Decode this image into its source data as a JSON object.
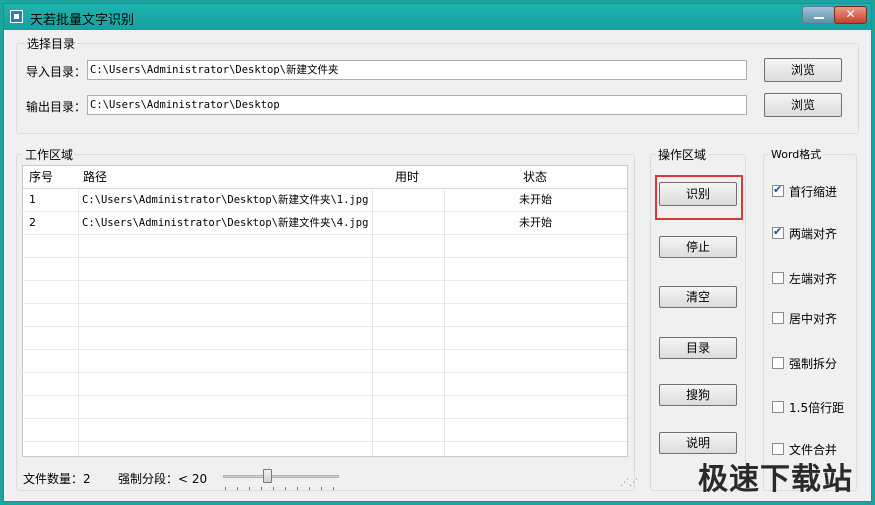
{
  "window": {
    "title": "天若批量文字识别",
    "minimize": "—",
    "close": "✕"
  },
  "directory_group": {
    "title": "选择目录",
    "import_label": "导入目录：",
    "import_value": "C:\\Users\\Administrator\\Desktop\\新建文件夹",
    "export_label": "输出目录：",
    "export_value": "C:\\Users\\Administrator\\Desktop",
    "browse_label": "浏览"
  },
  "work_area": {
    "title": "工作区域",
    "columns": [
      "序号",
      "路径",
      "用时",
      "状态"
    ],
    "rows": [
      {
        "index": "1",
        "path": "C:\\Users\\Administrator\\Desktop\\新建文件夹\\1.jpg",
        "time": "",
        "status": "未开始"
      },
      {
        "index": "2",
        "path": "C:\\Users\\Administrator\\Desktop\\新建文件夹\\4.jpg",
        "time": "",
        "status": "未开始"
      }
    ],
    "file_count_label": "文件数量：2",
    "split_label": "强制分段：< 20"
  },
  "operation_area": {
    "title": "操作区域",
    "buttons": [
      "识别",
      "停止",
      "清空",
      "目录",
      "搜狗",
      "说明"
    ],
    "highlight_color": "#d63a3a"
  },
  "word_format": {
    "title": "Word格式",
    "options": [
      {
        "label": "首行缩进",
        "checked": true
      },
      {
        "label": "两端对齐",
        "checked": true
      },
      {
        "label": "左端对齐",
        "checked": false
      },
      {
        "label": "居中对齐",
        "checked": false
      },
      {
        "label": "强制拆分",
        "checked": false
      },
      {
        "label": "1.5倍行距",
        "checked": false
      },
      {
        "label": "文件合并",
        "checked": false
      }
    ]
  },
  "watermark": "极速下载站"
}
